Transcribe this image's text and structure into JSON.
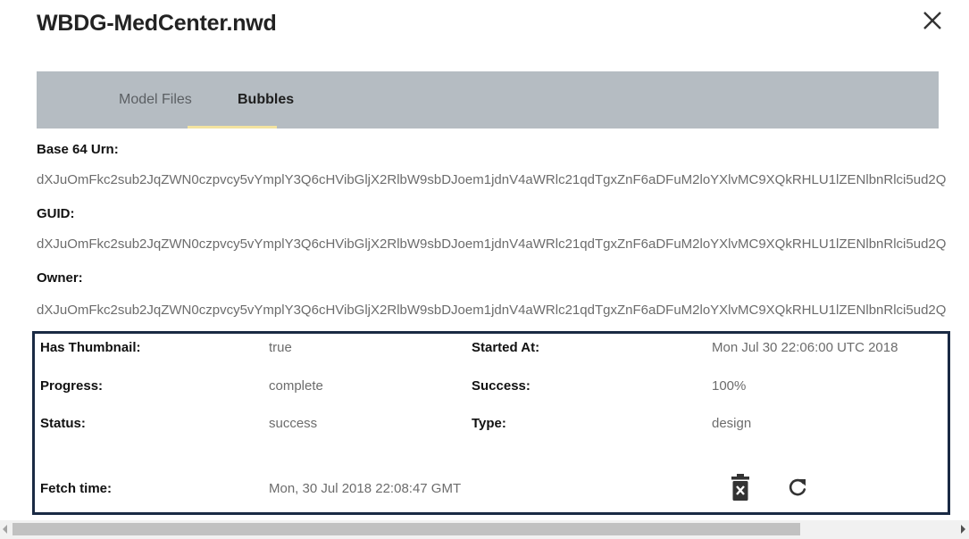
{
  "dialog": {
    "title": "WBDG-MedCenter.nwd",
    "close_icon": "close-icon"
  },
  "tabs": [
    {
      "label": "Model Files",
      "active": false
    },
    {
      "label": "Bubbles",
      "active": true
    }
  ],
  "info": {
    "urn_label": "Base 64 Urn:",
    "urn_value": "dXJuOmFkc2sub2JqZWN0czpvcy5vYmplY3Q6cHVibGljX2RlbW9sbDJoem1jdnV4aWRlc21qdTgxZnF6aDFuM2loYXlvMC9XQkRHLU1lZENlbnRlci5ud2Q",
    "guid_label": "GUID:",
    "guid_value": "dXJuOmFkc2sub2JqZWN0czpvcy5vYmplY3Q6cHVibGljX2RlbW9sbDJoem1jdnV4aWRlc21qdTgxZnF6aDFuM2loYXlvMC9XQkRHLU1lZENlbnRlci5ud2Q",
    "owner_label": "Owner:",
    "owner_value": "dXJuOmFkc2sub2JqZWN0czpvcy5vYmplY3Q6cHVibGljX2RlbW9sbDJoem1jdnV4aWRlc21qdTgxZnF6aDFuM2loYXlvMC9XQkRHLU1lZENlbnRlci5ud2Q"
  },
  "details": {
    "has_thumbnail_label": "Has Thumbnail:",
    "has_thumbnail_value": "true",
    "started_at_label": "Started At:",
    "started_at_value": "Mon Jul 30 22:06:00 UTC 2018",
    "progress_label": "Progress:",
    "progress_value": "complete",
    "success_label": "Success:",
    "success_value": "100%",
    "status_label": "Status:",
    "status_value": "success",
    "type_label": "Type:",
    "type_value": "design",
    "fetch_time_label": "Fetch time:",
    "fetch_time_value": "Mon, 30 Jul 2018 22:08:47 GMT"
  },
  "actions": {
    "delete_icon": "delete-icon",
    "refresh_icon": "refresh-icon"
  },
  "colors": {
    "tabbar_bg": "#b5bcc2",
    "tab_indicator": "#f3e3a0",
    "box_border": "#1a2a44"
  }
}
